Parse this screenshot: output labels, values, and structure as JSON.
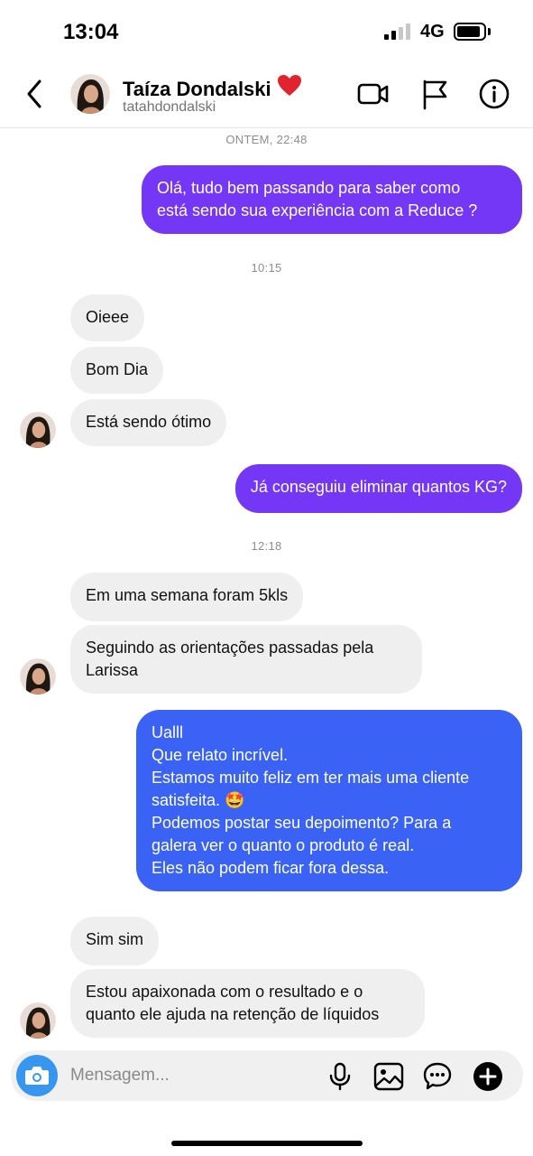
{
  "status_bar": {
    "time": "13:04",
    "network": "4G"
  },
  "header": {
    "name": "Taíza Dondalski",
    "handle": "tatahdondalski",
    "icons": [
      "back-icon",
      "video-call-icon",
      "flag-icon",
      "info-icon",
      "heart-emoji"
    ]
  },
  "timestamps": [
    "ONTEM, 22:48",
    "10:15",
    "12:18"
  ],
  "messages": [
    {
      "from": "me",
      "lines": [
        "Olá, tudo bem passando para saber como",
        "está sendo sua experiência com a Reduce ?"
      ]
    },
    {
      "from": "contact",
      "lines": [
        "Oieee"
      ]
    },
    {
      "from": "contact",
      "lines": [
        "Bom Dia"
      ]
    },
    {
      "from": "contact",
      "lines": [
        "Está sendo ótimo"
      ]
    },
    {
      "from": "me",
      "lines": [
        "Já conseguiu eliminar quantos KG?"
      ]
    },
    {
      "from": "contact",
      "lines": [
        "Em uma semana foram 5kls"
      ]
    },
    {
      "from": "contact",
      "lines": [
        "Seguindo as orientações passadas pela",
        "Larissa"
      ]
    },
    {
      "from": "me",
      "lines": [
        "Ualll",
        "Que relato incrível.",
        "Estamos muito feliz em ter mais uma cliente",
        "satisfeita. 🤩",
        "Podemos postar seu depoimento? Para a",
        "galera ver o quanto o produto é real.",
        "Eles não podem ficar fora dessa."
      ]
    },
    {
      "from": "contact",
      "lines": [
        "Sim sim"
      ]
    },
    {
      "from": "contact",
      "lines": [
        "Estou apaixonada com o resultado e o",
        "quanto ele ajuda na retenção de líquidos"
      ]
    }
  ],
  "composer": {
    "placeholder": "Mensagem...",
    "icons": [
      "camera-icon",
      "microphone-icon",
      "gallery-icon",
      "sticker-icon",
      "plus-icon"
    ]
  },
  "colors": {
    "outgoing_purple": "#7337f5",
    "outgoing_blue": "#3a63f6",
    "incoming": "#efefef",
    "camera_button": "#3797f0"
  }
}
